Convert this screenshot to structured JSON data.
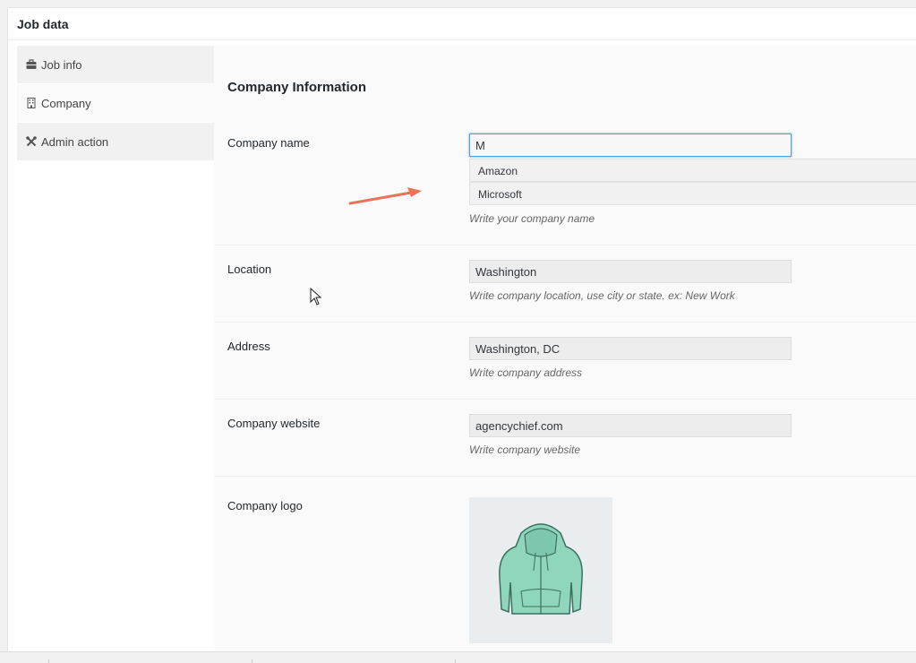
{
  "panel": {
    "title": "Job data"
  },
  "tabs": [
    {
      "label": "Job info",
      "icon": "briefcase-icon"
    },
    {
      "label": "Company",
      "icon": "building-icon"
    },
    {
      "label": "Admin action",
      "icon": "tools-icon"
    }
  ],
  "section": {
    "title": "Company Information"
  },
  "fields": {
    "company_name": {
      "label": "Company name",
      "value": "M",
      "description": "Write your company name",
      "suggestions": [
        "Amazon",
        "Microsoft"
      ]
    },
    "location": {
      "label": "Location",
      "value": "Washington",
      "description": "Write company location, use city or state. ex: New Work"
    },
    "address": {
      "label": "Address",
      "value": "Washington, DC",
      "description": "Write company address"
    },
    "website": {
      "label": "Company website",
      "value": "agencychief.com",
      "description": "Write company website"
    },
    "logo": {
      "label": "Company logo",
      "image": "hoodie-image"
    }
  },
  "colors": {
    "accent": "#5b9dd9",
    "arrow": "#e8755a",
    "hoodie": "#8fd6bd"
  }
}
